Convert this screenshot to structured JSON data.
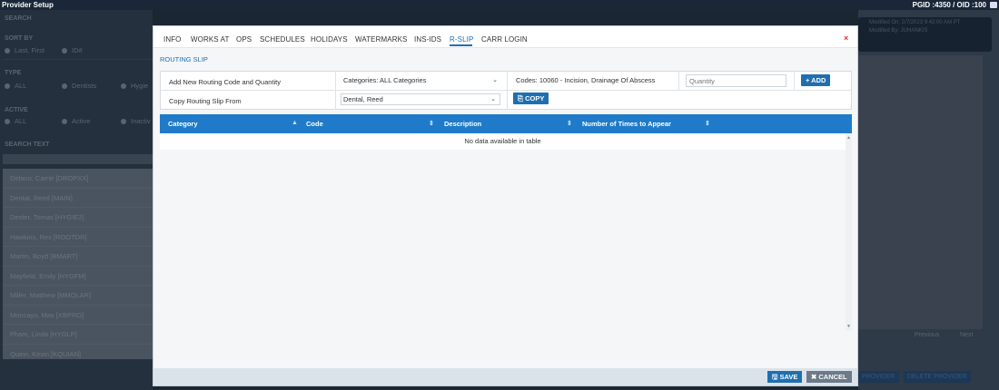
{
  "app": {
    "title": "Provider Setup",
    "ids": "PGID :4350  /  OID :100"
  },
  "sidebar": {
    "search_header": "SEARCH",
    "sort_by": "SORT BY",
    "sort_options": [
      "Last, First",
      "ID#"
    ],
    "type": "TYPE",
    "type_options": [
      "ALL",
      "Dentists",
      "Hygie"
    ],
    "active": "ACTIVE",
    "active_options": [
      "ALL",
      "Active",
      "Inactiv"
    ],
    "search_text": "SEARCH TEXT",
    "providers": [
      "Delano, Carrie [DROPXX]",
      "Dental, Reed [MAIN]",
      "Dexter, Tomas [HYGIE2]",
      "Hawkins, Rex [ROOTDR]",
      "Martin, Boyd [BMART]",
      "Mayfield, Emily [HYGFM]",
      "Miller, Matthew [MMOLAR]",
      "Moncayo, Max [XBPRO]",
      "Pham, Linda [HYGLP]",
      "Quinn, Kevin [KQUIAN]"
    ]
  },
  "main_bg": {
    "modified_on": "Modified On: 2/7/2023 9:42:00 AM PT",
    "modified_by": "Modified By: JUHANKIS",
    "pager_prev": "Previous",
    "pager_next": "Next",
    "add_provider": "PROVIDER",
    "delete_provider": "DELETE PROVIDER"
  },
  "modal": {
    "tabs": [
      "INFO",
      "WORKS AT",
      "OPS",
      "SCHEDULES",
      "HOLIDAYS",
      "WATERMARKS",
      "INS-IDS",
      "R-SLIP",
      "CARR LOGIN"
    ],
    "active_tab": "R-SLIP",
    "close": "×",
    "section_title": "ROUTING SLIP",
    "add_label": "Add New Routing Code and Quantity",
    "categories_value": "Categories: ALL Categories",
    "codes_value": "Codes: 10060 - Incision, Drainage Of Abscess",
    "quantity_placeholder": "Quantity",
    "add_button": "+ ADD",
    "copy_label": "Copy Routing Slip From",
    "copy_from_value": "Dental, Reed",
    "copy_button": "COPY",
    "table": {
      "headers": [
        "Category",
        "Code",
        "Description",
        "Number of Times to Appear"
      ],
      "empty": "No data available in table"
    },
    "save_button": "SAVE",
    "cancel_button": "CANCEL"
  },
  "colors": {
    "accent": "#1f6fb0",
    "table_header": "#1f7bc9",
    "close": "#d9302f"
  }
}
